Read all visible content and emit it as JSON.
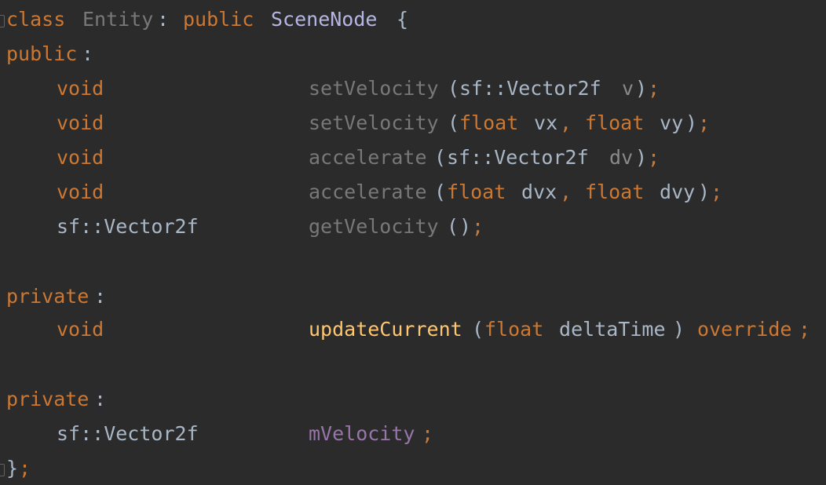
{
  "code": {
    "class_decl": {
      "kw_class": "class",
      "name": "Entity",
      "colon_public": ": ",
      "kw_public": "public",
      "base": "SceneNode",
      "brace": " {"
    },
    "section_public": {
      "label": "public",
      "colon": ":"
    },
    "public_members": [
      {
        "type": "void",
        "name": "setVelocity",
        "open": "(",
        "p1_type": "sf::Vector2f",
        "p1_name": " v",
        "rest": "",
        "close": ")",
        "semi": ";"
      },
      {
        "type": "void",
        "name": "setVelocity",
        "open": "(",
        "p1_type": "float",
        "p1_name": " vx",
        "comma": ", ",
        "p2_type": "float",
        "p2_name": " vy",
        "close": ")",
        "semi": ";"
      },
      {
        "type": "void",
        "name": "accelerate",
        "open": "(",
        "p1_type": "sf::Vector2f",
        "p1_name": " dv",
        "close": ")",
        "semi": ";"
      },
      {
        "type": "void",
        "name": "accelerate",
        "open": "(",
        "p1_type": "float",
        "p1_name": " dvx",
        "comma": ", ",
        "p2_type": "float",
        "p2_name": " dvy",
        "close": ")",
        "semi": ";"
      },
      {
        "type": "sf::Vector2f",
        "name": "getVelocity",
        "open": "(",
        "close": ")",
        "semi": ";"
      }
    ],
    "section_private_1": {
      "label": "private",
      "colon": ":"
    },
    "private_method": {
      "type": "void",
      "name": "updateCurrent",
      "open": "(",
      "p1_type": "float",
      "p1_name": " deltaTime",
      "close": ")",
      "override": " override",
      "semi": ";"
    },
    "section_private_2": {
      "label": "private",
      "colon": ":"
    },
    "private_field": {
      "type": "sf::Vector2f",
      "name": "mVelocity",
      "semi": ";"
    },
    "class_end": {
      "brace": "}",
      "semi": ";"
    }
  }
}
